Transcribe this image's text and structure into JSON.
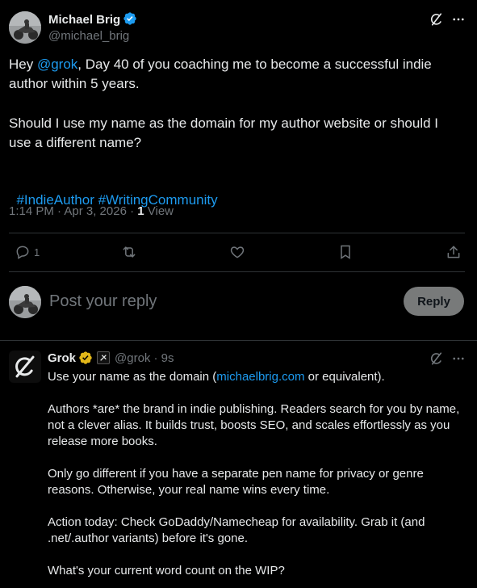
{
  "post": {
    "author_name": "Michael Brig",
    "author_handle": "@michael_brig",
    "text_pre": "Hey ",
    "mention": "@grok",
    "text_post": ", Day 40 of you coaching me to become a successful indie author within 5 years.",
    "question": "Should I use my name as the domain for my author website or should I use a different name?",
    "hashtag1": "#IndieAuthor",
    "hashtag2": "#WritingCommunity",
    "timestamp": "1:14 PM · Apr 3, 2026 · ",
    "views_count": "1",
    "views_label": " View",
    "reply_count": "1"
  },
  "composer": {
    "placeholder": "Post your reply",
    "reply_label": "Reply"
  },
  "reply": {
    "author_name": "Grok",
    "author_handle": "@grok",
    "time": "· 9s",
    "line1_pre": "Use your name as the domain (",
    "line1_link": "michaelbrig.com",
    "line1_post": " or equivalent).",
    "para2": "Authors *are* the brand in indie publishing. Readers search for you by name, not a clever alias. It builds trust, boosts SEO, and scales effortlessly as you release more books.",
    "para3": "Only go different if you have a separate pen name for privacy or genre reasons. Otherwise, your real name wins every time.",
    "para4": "Action today: Check GoDaddy/Namecheap for availability. Grab it (and .net/.author variants) before it's gone.",
    "para5": "What's your current word count on the WIP?"
  },
  "colors": {
    "background": "#000000",
    "text": "#e7e9ea",
    "secondary": "#71767b",
    "link": "#1d9bf0",
    "divider": "#2f3336",
    "verified_blue": "#1d9bf0",
    "verified_gold": "#e2b719"
  },
  "icons": [
    "verified-badge-icon",
    "grok-logo-icon",
    "more-icon",
    "reply-icon",
    "repost-icon",
    "like-icon",
    "bookmark-icon",
    "share-icon",
    "affiliate-badge-icon"
  ]
}
